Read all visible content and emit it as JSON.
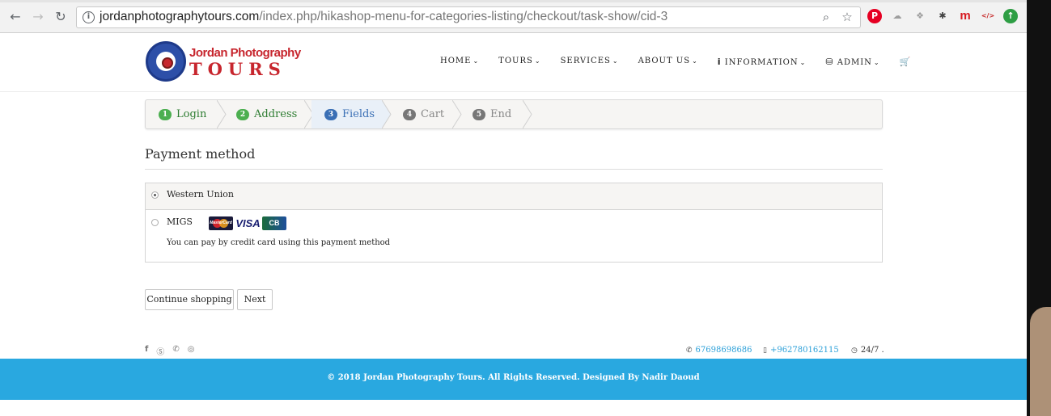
{
  "browser": {
    "url_host": "jordanphotographytours.com",
    "url_path": "/index.php/hikashop-menu-for-categories-listing/checkout/task-show/cid-3",
    "back_icon": "arrow-left",
    "forward_icon": "arrow-right",
    "reload_icon": "reload",
    "zoom_icon": "magnifier",
    "star_icon": "star",
    "extensions": [
      {
        "name": "pinterest",
        "glyph": "P",
        "color": "#e60023"
      },
      {
        "name": "cloud",
        "glyph": "☁",
        "color": "#9e9e9e"
      },
      {
        "name": "dropbox",
        "glyph": "❖",
        "color": "#9e9e9e"
      },
      {
        "name": "bug",
        "glyph": "✱",
        "color": "#444"
      },
      {
        "name": "mendeley",
        "glyph": "m",
        "color": "#d71920"
      },
      {
        "name": "code",
        "glyph": "</>",
        "color": "#c62828"
      },
      {
        "name": "upload",
        "glyph": "↑",
        "color": "#2e9e44"
      }
    ]
  },
  "logo": {
    "line1": "Jordan Photography",
    "line2": "TOURS"
  },
  "nav": {
    "home": "HOME",
    "tours": "TOURS",
    "services": "SERVICES",
    "about": "ABOUT US",
    "information": "INFORMATION",
    "admin": "ADMIN",
    "chevron": "⌄",
    "cart_icon": "🛒"
  },
  "steps": [
    {
      "num": "1",
      "label": "Login",
      "state": "done"
    },
    {
      "num": "2",
      "label": "Address",
      "state": "done"
    },
    {
      "num": "3",
      "label": "Fields",
      "state": "active"
    },
    {
      "num": "4",
      "label": "Cart",
      "state": "todo"
    },
    {
      "num": "5",
      "label": "End",
      "state": "todo"
    }
  ],
  "payment": {
    "title": "Payment method",
    "methods": [
      {
        "label": "Western Union",
        "selected": true
      },
      {
        "label": "MIGS",
        "selected": false,
        "description": "You can pay by credit card using this payment method",
        "cards": [
          "MasterCard",
          "VISA",
          "CB"
        ]
      }
    ]
  },
  "buttons": {
    "continue": "Continue shopping",
    "next": "Next"
  },
  "footer": {
    "social_icons": [
      "facebook",
      "skype",
      "whatsapp",
      "instagram"
    ],
    "phone1": "67698698686",
    "phone2": "+962780162115",
    "hours": "24/7 .",
    "copyright": "© 2018 Jordan Photography Tours. All Rights Reserved. Designed By Nadir Daoud",
    "accent": "#29a8e0"
  }
}
